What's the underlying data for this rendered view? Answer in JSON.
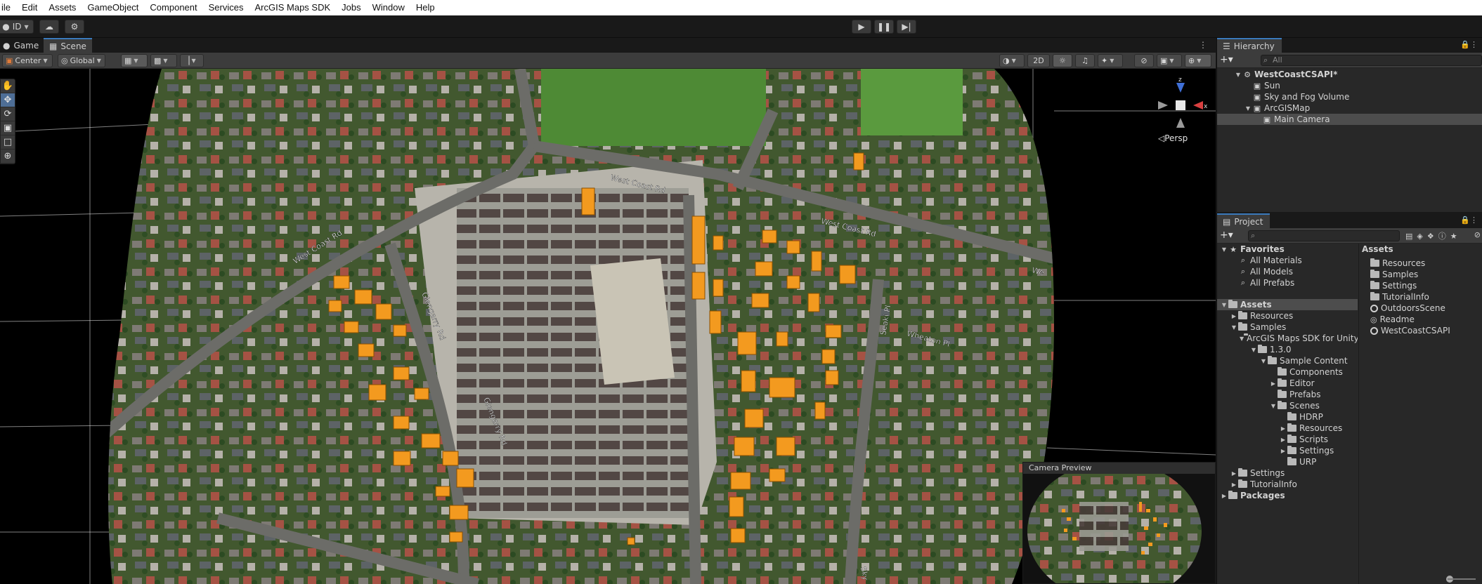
{
  "menu": [
    "ile",
    "Edit",
    "Assets",
    "GameObject",
    "Component",
    "Services",
    "ArcGIS Maps SDK",
    "Jobs",
    "Window",
    "Help"
  ],
  "toolbar": {
    "account_label": "ID",
    "play_icon": "play-icon",
    "pause_icon": "pause-icon",
    "step_icon": "step-icon"
  },
  "scene_tabs": {
    "game": "Game",
    "scene": "Scene"
  },
  "scene_toolbar": {
    "pivot": "Center",
    "space": "Global",
    "mode_2d": "2D"
  },
  "viewport": {
    "persp_label": "◁Persp",
    "gizmo_labels": {
      "z": "z",
      "x": "x"
    },
    "street_labels": [
      "West Coast Rd",
      "West Coast Rd",
      "West Coast Rd",
      "We",
      "Glengarry Rd",
      "Glengarry Rd",
      "Seaki Pl",
      "Wheaton Pl",
      "Sky"
    ],
    "camera_preview_title": "Camera Preview"
  },
  "hierarchy": {
    "title": "Hierarchy",
    "search_placeholder": "All",
    "items": [
      {
        "label": "WestCoastCSAPI*",
        "depth": 0,
        "expanded": true,
        "bold": true,
        "icon": "unity-scene-icon"
      },
      {
        "label": "Sun",
        "depth": 1,
        "icon": "gameobject-icon"
      },
      {
        "label": "Sky and Fog Volume",
        "depth": 1,
        "icon": "gameobject-icon"
      },
      {
        "label": "ArcGISMap",
        "depth": 1,
        "expanded": true,
        "icon": "gameobject-icon"
      },
      {
        "label": "Main Camera",
        "depth": 2,
        "selected": true,
        "icon": "gameobject-icon"
      }
    ]
  },
  "project": {
    "title": "Project",
    "favorites": {
      "label": "Favorites",
      "items": [
        "All Materials",
        "All Models",
        "All Prefabs"
      ]
    },
    "tree": [
      {
        "label": "Assets",
        "depth": 0,
        "expanded": true,
        "bold": true,
        "selected": true
      },
      {
        "label": "Resources",
        "depth": 1
      },
      {
        "label": "Samples",
        "depth": 1,
        "expanded": true
      },
      {
        "label": "ArcGIS Maps SDK for Unity",
        "depth": 2,
        "expanded": true
      },
      {
        "label": "1.3.0",
        "depth": 3,
        "expanded": true
      },
      {
        "label": "Sample Content",
        "depth": 4,
        "expanded": true
      },
      {
        "label": "Components",
        "depth": 5,
        "leaf": true
      },
      {
        "label": "Editor",
        "depth": 5
      },
      {
        "label": "Prefabs",
        "depth": 5,
        "leaf": true
      },
      {
        "label": "Scenes",
        "depth": 5,
        "expanded": true
      },
      {
        "label": "HDRP",
        "depth": 6,
        "leaf": true
      },
      {
        "label": "Resources",
        "depth": 6
      },
      {
        "label": "Scripts",
        "depth": 6
      },
      {
        "label": "Settings",
        "depth": 6
      },
      {
        "label": "URP",
        "depth": 6,
        "leaf": true
      },
      {
        "label": "Settings",
        "depth": 1
      },
      {
        "label": "TutorialInfo",
        "depth": 1
      },
      {
        "label": "Packages",
        "depth": 0,
        "bold": true
      }
    ],
    "assets_header": "Assets",
    "assets": [
      {
        "label": "Resources",
        "icon": "folder-icon"
      },
      {
        "label": "Samples",
        "icon": "folder-icon"
      },
      {
        "label": "Settings",
        "icon": "folder-icon"
      },
      {
        "label": "TutorialInfo",
        "icon": "folder-icon"
      },
      {
        "label": "OutdoorsScene",
        "icon": "unity-scene-icon"
      },
      {
        "label": "Readme",
        "icon": "readme-icon"
      },
      {
        "label": "WestCoastCSAPI",
        "icon": "unity-scene-icon"
      }
    ]
  },
  "colors": {
    "accent": "#3a79bb",
    "building": "#f39a1f",
    "panel_bg": "#282828",
    "toolbar_bg": "#3c3c3c"
  }
}
